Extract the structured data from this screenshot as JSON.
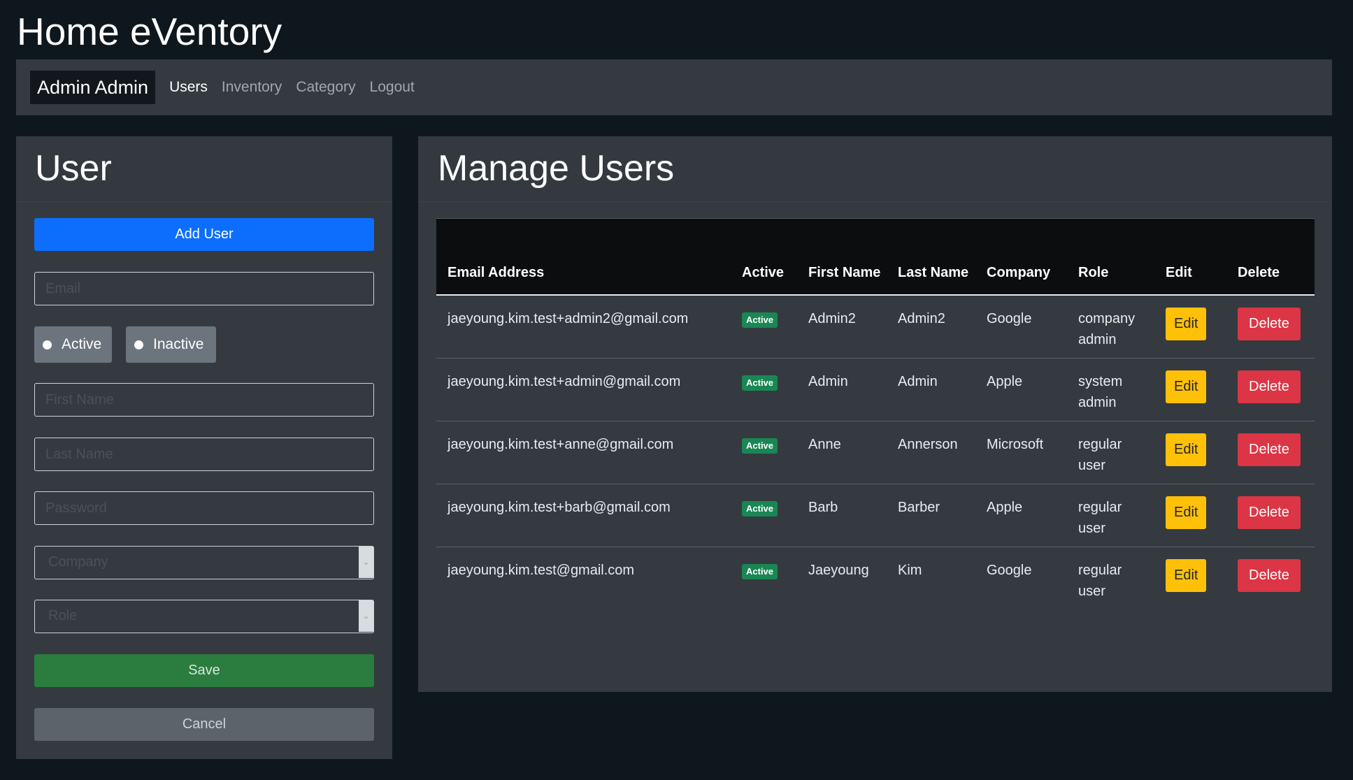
{
  "app": {
    "title": "Home eVentory"
  },
  "navbar": {
    "brand": "Admin Admin",
    "links": [
      "Users",
      "Inventory",
      "Category",
      "Logout"
    ],
    "active": "Users"
  },
  "user_form": {
    "title": "User",
    "add_button": "Add User",
    "email_placeholder": "Email",
    "status_options": [
      "Active",
      "Inactive"
    ],
    "first_name_placeholder": "First Name",
    "last_name_placeholder": "Last Name",
    "password_placeholder": "Password",
    "company_placeholder": "Company",
    "role_placeholder": "Role",
    "save_button": "Save",
    "cancel_button": "Cancel"
  },
  "manage_users": {
    "title": "Manage Users",
    "columns": [
      "Email Address",
      "Active",
      "First Name",
      "Last Name",
      "Company",
      "Role",
      "Edit",
      "Delete"
    ],
    "rows": [
      {
        "email": "jaeyoung.kim.test+admin2@gmail.com",
        "active": "Active",
        "first": "Admin2",
        "last": "Admin2",
        "company": "Google",
        "role": "company admin",
        "edit": "Edit",
        "delete": "Delete"
      },
      {
        "email": "jaeyoung.kim.test+admin@gmail.com",
        "active": "Active",
        "first": "Admin",
        "last": "Admin",
        "company": "Apple",
        "role": "system admin",
        "edit": "Edit",
        "delete": "Delete"
      },
      {
        "email": "jaeyoung.kim.test+anne@gmail.com",
        "active": "Active",
        "first": "Anne",
        "last": "Annerson",
        "company": "Microsoft",
        "role": "regular user",
        "edit": "Edit",
        "delete": "Delete"
      },
      {
        "email": "jaeyoung.kim.test+barb@gmail.com",
        "active": "Active",
        "first": "Barb",
        "last": "Barber",
        "company": "Apple",
        "role": "regular user",
        "edit": "Edit",
        "delete": "Delete"
      },
      {
        "email": "jaeyoung.kim.test@gmail.com",
        "active": "Active",
        "first": "Jaeyoung",
        "last": "Kim",
        "company": "Google",
        "role": "regular user",
        "edit": "Edit",
        "delete": "Delete"
      }
    ]
  },
  "colors": {
    "background": "#0f171e",
    "panel": "#343a40",
    "primary": "#0d6efd",
    "success": "#198754",
    "warning": "#ffc107",
    "danger": "#dc3545"
  }
}
